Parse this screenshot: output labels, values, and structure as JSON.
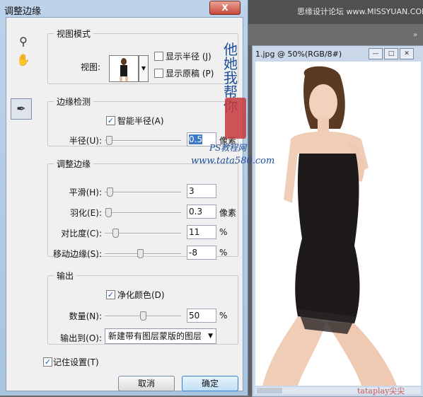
{
  "app": {
    "forum_text": "思缘设计论坛 www.MISSYUAN.COM",
    "doc_title": "1.jpg @ 50%(RGB/8#)",
    "doc_footer": "tataplay尖尖"
  },
  "dialog": {
    "title": "调整边缘",
    "close_label": "X",
    "view_mode": {
      "legend": "视图模式",
      "view_label": "视图:",
      "show_radius": "显示半径 (J)",
      "show_original": "显示原稿 (P)",
      "show_radius_checked": false,
      "show_original_checked": false
    },
    "edge_detection": {
      "legend": "边缘检测",
      "smart_radius": "智能半径(A)",
      "smart_radius_checked": true,
      "radius_label": "半径(U):",
      "radius_value": "0.5",
      "radius_unit": "像素",
      "radius_level": 0.02
    },
    "adjust_edge": {
      "legend": "调整边缘",
      "rows": [
        {
          "label": "平滑(H):",
          "value": "3",
          "unit": "",
          "level": 0.03
        },
        {
          "label": "羽化(E):",
          "value": "0.3",
          "unit": "像素",
          "level": 0.01
        },
        {
          "label": "对比度(C):",
          "value": "11",
          "unit": "%",
          "level": 0.11
        },
        {
          "label": "移动边缘(S):",
          "value": "-8",
          "unit": "%",
          "level": 0.46
        }
      ]
    },
    "output": {
      "legend": "输出",
      "decontaminate": "净化颜色(D)",
      "decontaminate_checked": true,
      "amount_label": "数量(N):",
      "amount_value": "50",
      "amount_unit": "%",
      "amount_level": 0.5,
      "output_to_label": "输出到(O):",
      "output_to_value": "新建带有图层蒙版的图层"
    },
    "remember": "记住设置(T)",
    "remember_checked": true,
    "cancel": "取消",
    "ok": "确定"
  },
  "watermark": {
    "vertical": "他她我帮你",
    "ps": "PS教程网",
    "url": "www.tata580.com"
  },
  "colors": {
    "accent": "#3b78c8",
    "close": "#c8473a",
    "watermark": "#1d4e9a"
  }
}
